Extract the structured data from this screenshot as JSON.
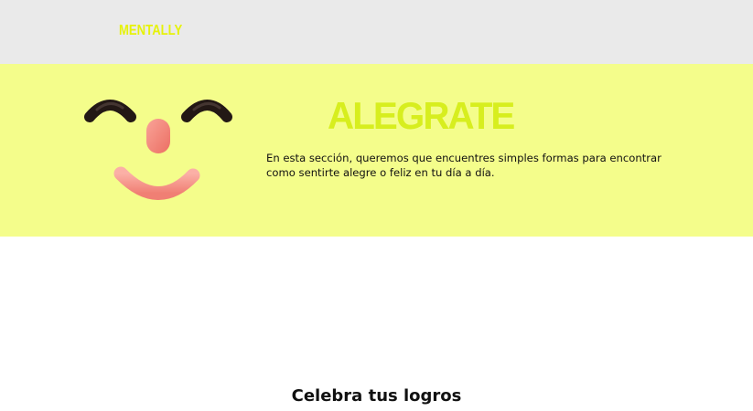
{
  "header": {
    "logo_text": "MENTALLY",
    "background": "#eaeaea",
    "logo_color": "#e6f20a"
  },
  "hero": {
    "title": "ALEGRATE",
    "description": "En esta sección, queremos que encuentres simples formas para encontrar como sentirte alegre o feliz en tu día a día.",
    "background": "#f4fd8b",
    "title_color": "#d7ee1e",
    "illustration": "smiley-face-icon",
    "face_colors": {
      "eyebrows": "#231815",
      "nose": "#f58a7f",
      "mouth": "#f7938a"
    }
  },
  "section": {
    "title": "Celebra tus logros"
  }
}
